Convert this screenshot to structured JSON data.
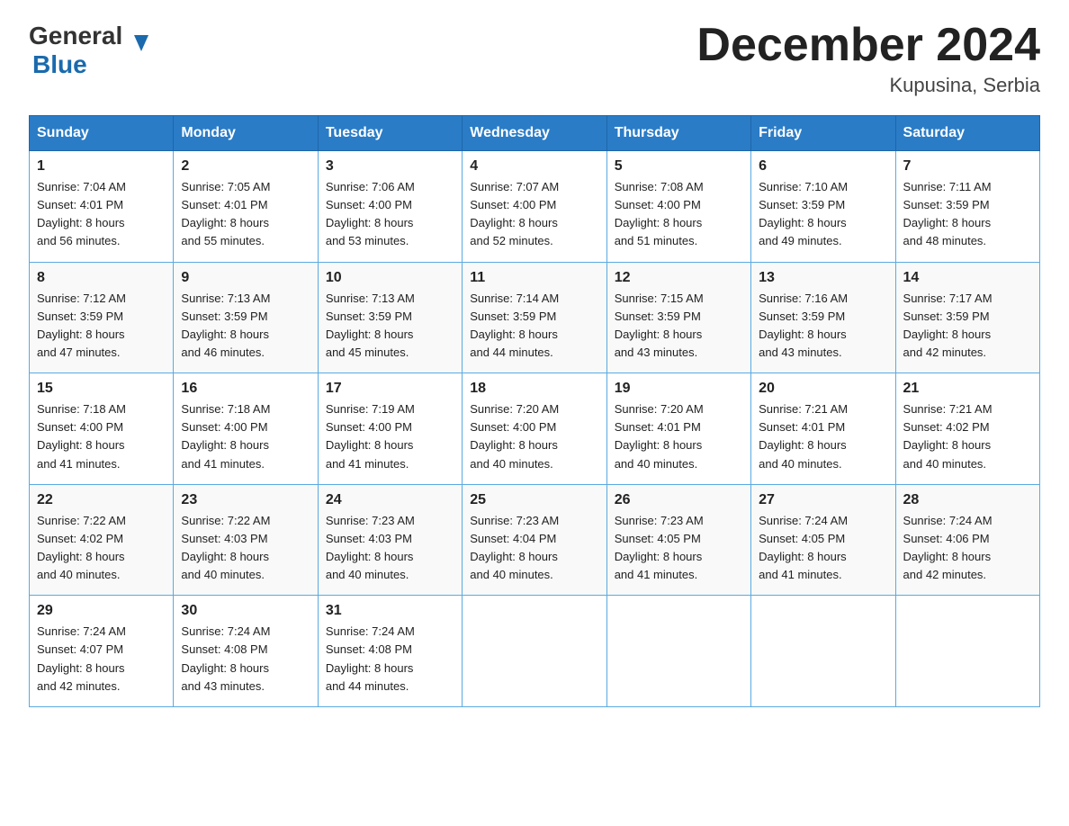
{
  "logo": {
    "general": "General",
    "blue": "Blue",
    "arrow_color": "#1a6aad"
  },
  "header": {
    "month_year": "December 2024",
    "location": "Kupusina, Serbia"
  },
  "days_of_week": [
    "Sunday",
    "Monday",
    "Tuesday",
    "Wednesday",
    "Thursday",
    "Friday",
    "Saturday"
  ],
  "weeks": [
    [
      {
        "day": "1",
        "sunrise": "7:04 AM",
        "sunset": "4:01 PM",
        "daylight": "8 hours and 56 minutes."
      },
      {
        "day": "2",
        "sunrise": "7:05 AM",
        "sunset": "4:01 PM",
        "daylight": "8 hours and 55 minutes."
      },
      {
        "day": "3",
        "sunrise": "7:06 AM",
        "sunset": "4:00 PM",
        "daylight": "8 hours and 53 minutes."
      },
      {
        "day": "4",
        "sunrise": "7:07 AM",
        "sunset": "4:00 PM",
        "daylight": "8 hours and 52 minutes."
      },
      {
        "day": "5",
        "sunrise": "7:08 AM",
        "sunset": "4:00 PM",
        "daylight": "8 hours and 51 minutes."
      },
      {
        "day": "6",
        "sunrise": "7:10 AM",
        "sunset": "3:59 PM",
        "daylight": "8 hours and 49 minutes."
      },
      {
        "day": "7",
        "sunrise": "7:11 AM",
        "sunset": "3:59 PM",
        "daylight": "8 hours and 48 minutes."
      }
    ],
    [
      {
        "day": "8",
        "sunrise": "7:12 AM",
        "sunset": "3:59 PM",
        "daylight": "8 hours and 47 minutes."
      },
      {
        "day": "9",
        "sunrise": "7:13 AM",
        "sunset": "3:59 PM",
        "daylight": "8 hours and 46 minutes."
      },
      {
        "day": "10",
        "sunrise": "7:13 AM",
        "sunset": "3:59 PM",
        "daylight": "8 hours and 45 minutes."
      },
      {
        "day": "11",
        "sunrise": "7:14 AM",
        "sunset": "3:59 PM",
        "daylight": "8 hours and 44 minutes."
      },
      {
        "day": "12",
        "sunrise": "7:15 AM",
        "sunset": "3:59 PM",
        "daylight": "8 hours and 43 minutes."
      },
      {
        "day": "13",
        "sunrise": "7:16 AM",
        "sunset": "3:59 PM",
        "daylight": "8 hours and 43 minutes."
      },
      {
        "day": "14",
        "sunrise": "7:17 AM",
        "sunset": "3:59 PM",
        "daylight": "8 hours and 42 minutes."
      }
    ],
    [
      {
        "day": "15",
        "sunrise": "7:18 AM",
        "sunset": "4:00 PM",
        "daylight": "8 hours and 41 minutes."
      },
      {
        "day": "16",
        "sunrise": "7:18 AM",
        "sunset": "4:00 PM",
        "daylight": "8 hours and 41 minutes."
      },
      {
        "day": "17",
        "sunrise": "7:19 AM",
        "sunset": "4:00 PM",
        "daylight": "8 hours and 41 minutes."
      },
      {
        "day": "18",
        "sunrise": "7:20 AM",
        "sunset": "4:00 PM",
        "daylight": "8 hours and 40 minutes."
      },
      {
        "day": "19",
        "sunrise": "7:20 AM",
        "sunset": "4:01 PM",
        "daylight": "8 hours and 40 minutes."
      },
      {
        "day": "20",
        "sunrise": "7:21 AM",
        "sunset": "4:01 PM",
        "daylight": "8 hours and 40 minutes."
      },
      {
        "day": "21",
        "sunrise": "7:21 AM",
        "sunset": "4:02 PM",
        "daylight": "8 hours and 40 minutes."
      }
    ],
    [
      {
        "day": "22",
        "sunrise": "7:22 AM",
        "sunset": "4:02 PM",
        "daylight": "8 hours and 40 minutes."
      },
      {
        "day": "23",
        "sunrise": "7:22 AM",
        "sunset": "4:03 PM",
        "daylight": "8 hours and 40 minutes."
      },
      {
        "day": "24",
        "sunrise": "7:23 AM",
        "sunset": "4:03 PM",
        "daylight": "8 hours and 40 minutes."
      },
      {
        "day": "25",
        "sunrise": "7:23 AM",
        "sunset": "4:04 PM",
        "daylight": "8 hours and 40 minutes."
      },
      {
        "day": "26",
        "sunrise": "7:23 AM",
        "sunset": "4:05 PM",
        "daylight": "8 hours and 41 minutes."
      },
      {
        "day": "27",
        "sunrise": "7:24 AM",
        "sunset": "4:05 PM",
        "daylight": "8 hours and 41 minutes."
      },
      {
        "day": "28",
        "sunrise": "7:24 AM",
        "sunset": "4:06 PM",
        "daylight": "8 hours and 42 minutes."
      }
    ],
    [
      {
        "day": "29",
        "sunrise": "7:24 AM",
        "sunset": "4:07 PM",
        "daylight": "8 hours and 42 minutes."
      },
      {
        "day": "30",
        "sunrise": "7:24 AM",
        "sunset": "4:08 PM",
        "daylight": "8 hours and 43 minutes."
      },
      {
        "day": "31",
        "sunrise": "7:24 AM",
        "sunset": "4:08 PM",
        "daylight": "8 hours and 44 minutes."
      },
      null,
      null,
      null,
      null
    ]
  ],
  "labels": {
    "sunrise": "Sunrise:",
    "sunset": "Sunset:",
    "daylight": "Daylight:"
  }
}
